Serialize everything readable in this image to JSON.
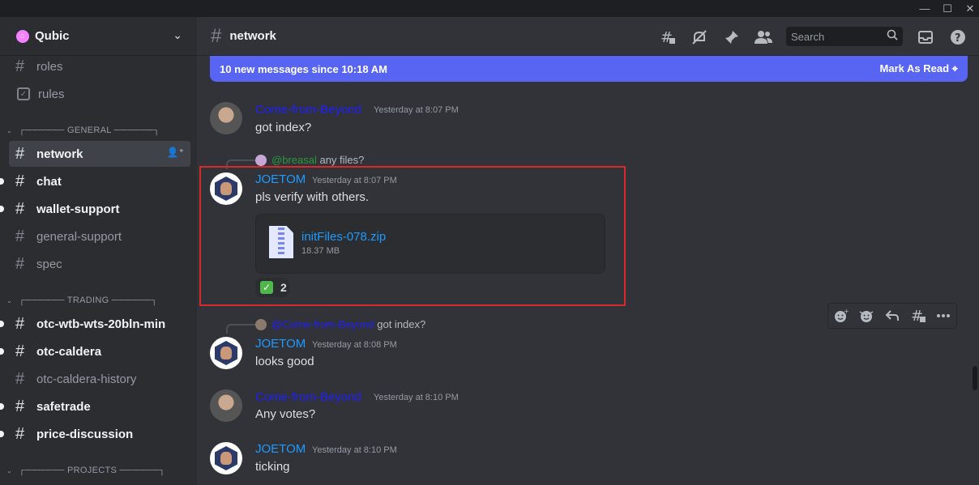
{
  "window": {
    "minimize": "—",
    "maximize": "☐",
    "close": "✕"
  },
  "server": {
    "name": "Qubic",
    "icon": "home-icon"
  },
  "sidebar": {
    "channels_top": [
      {
        "name": "roles",
        "type": "text",
        "state": "muted"
      },
      {
        "name": "rules",
        "type": "rules",
        "state": "muted"
      }
    ],
    "categories": [
      {
        "label": "┌────── GENERAL ──────┐"
      },
      {
        "label": "┌────── TRADING ──────┐"
      },
      {
        "label": "┌────── PROJECTS ──────┐"
      }
    ],
    "general": [
      {
        "name": "network",
        "state": "selected"
      },
      {
        "name": "chat",
        "state": "unread"
      },
      {
        "name": "wallet-support",
        "state": "unread"
      },
      {
        "name": "general-support",
        "state": "muted"
      },
      {
        "name": "spec",
        "state": "muted"
      }
    ],
    "trading": [
      {
        "name": "otc-wtb-wts-20bln-min",
        "state": "unread"
      },
      {
        "name": "otc-caldera",
        "state": "unread"
      },
      {
        "name": "otc-caldera-history",
        "state": "muted"
      },
      {
        "name": "safetrade",
        "state": "unread"
      },
      {
        "name": "price-discussion",
        "state": "unread"
      }
    ]
  },
  "header": {
    "channel": "network",
    "search_placeholder": "Search",
    "icons": [
      "threads-icon",
      "notification-muted-icon",
      "pin-icon",
      "members-icon",
      "search-icon",
      "inbox-icon",
      "help-icon"
    ]
  },
  "banner": {
    "text": "10 new messages since 10:18 AM",
    "action": "Mark As Read"
  },
  "messages": [
    {
      "author": "Come-from-Beyond",
      "time": "Yesterday at 8:07 PM",
      "text": "got index?"
    },
    {
      "reply_to": "@breasal",
      "reply_text": "any files?",
      "author": "JOETOM",
      "time": "Yesterday at 8:07 PM",
      "text": "pls verify with others.",
      "attachment": {
        "name": "initFiles-078.zip",
        "size": "18.37 MB"
      },
      "reaction": {
        "emoji": "✓",
        "count": "2"
      }
    },
    {
      "reply_to": "@Come-from-Beyond",
      "reply_text": "got index?",
      "author": "JOETOM",
      "time": "Yesterday at 8:08 PM",
      "text": "looks good"
    },
    {
      "author": "Come-from-Beyond",
      "time": "Yesterday at 8:10 PM",
      "text": "Any votes?"
    },
    {
      "author": "JOETOM",
      "time": "Yesterday at 8:10 PM",
      "text": "ticking"
    }
  ],
  "hover_toolbar": [
    "add-reaction-icon",
    "super-reaction-icon",
    "reply-icon",
    "create-thread-icon",
    "more-icon"
  ],
  "colors": {
    "accent": "#5865f2",
    "highlight": "#d62a2a",
    "cfb_name": "#1f1fff",
    "joe_name": "#1e9bff"
  }
}
